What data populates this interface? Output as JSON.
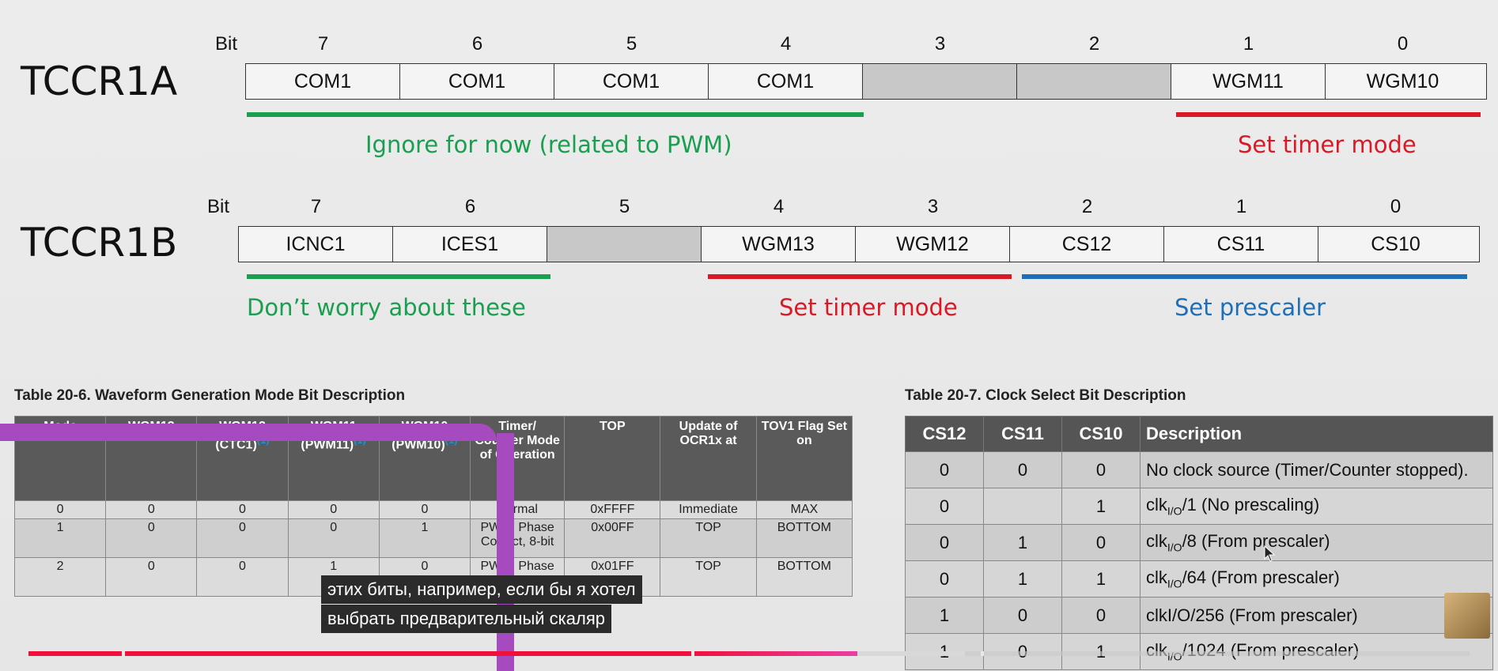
{
  "tccr1a": {
    "name": "TCCR1A",
    "bit_label": "Bit",
    "bits": [
      "7",
      "6",
      "5",
      "4",
      "3",
      "2",
      "1",
      "0"
    ],
    "cells": [
      "COM1",
      "COM1",
      "COM1",
      "COM1",
      "",
      "",
      "WGM11",
      "WGM10"
    ],
    "notes": [
      "Ignore for now (related to PWM)",
      "Set timer mode"
    ]
  },
  "tccr1b": {
    "name": "TCCR1B",
    "bit_label": "Bit",
    "bits": [
      "7",
      "6",
      "5",
      "4",
      "3",
      "2",
      "1",
      "0"
    ],
    "cells": [
      "ICNC1",
      "ICES1",
      "",
      "WGM13",
      "WGM12",
      "CS12",
      "CS11",
      "CS10"
    ],
    "notes": [
      "Don’t worry about these",
      "Set timer mode",
      "Set prescaler"
    ]
  },
  "wgm_table": {
    "title": "Table 20-6.  Waveform Generation Mode Bit Description",
    "headers": [
      "Mode",
      "WGM13",
      "WGM12",
      "WGM11",
      "WGM10",
      "Timer/ Counter Mode of Operation",
      "TOP",
      "Update of OCR1x at",
      "TOV1 Flag Set on"
    ],
    "sub_headers": [
      "",
      "",
      "(CTC1)",
      "(PWM11)",
      "(PWM10)",
      "",
      "",
      "",
      ""
    ],
    "footnote_mark": "(1)",
    "rows": [
      [
        "0",
        "0",
        "0",
        "0",
        "0",
        "Normal",
        "0xFFFF",
        "Immediate",
        "MAX"
      ],
      [
        "1",
        "0",
        "0",
        "0",
        "1",
        "PWM, Phase Correct, 8-bit",
        "0x00FF",
        "TOP",
        "BOTTOM"
      ],
      [
        "2",
        "0",
        "0",
        "1",
        "0",
        "PWM, Phase",
        "0x01FF",
        "TOP",
        "BOTTOM"
      ]
    ]
  },
  "cs_table": {
    "title": "Table 20-7.  Clock Select Bit Description",
    "headers": [
      "CS12",
      "CS11",
      "CS10",
      "Description"
    ],
    "rows": [
      [
        "0",
        "0",
        "0",
        "No clock source (Timer/Counter stopped)."
      ],
      [
        "0",
        "",
        "1",
        "clkI/O/1 (No prescaling)"
      ],
      [
        "0",
        "1",
        "0",
        "clkI/O/8 (From prescaler)"
      ],
      [
        "0",
        "1",
        "1",
        "clkI/O/64 (From prescaler)"
      ],
      [
        "1",
        "0",
        "0",
        "clkI/O/256 (From prescaler)"
      ],
      [
        "1",
        "0",
        "1",
        "clkI/O/1024 (From prescaler)"
      ]
    ]
  },
  "subtitles": {
    "line1": "этих  биты, например, если бы я хотел",
    "line2": "выбрать предварительный скаляр"
  },
  "video": {
    "progress": 0.575,
    "buffered": 0.65
  },
  "colors": {
    "green": "#1a9e50",
    "red": "#d91a26",
    "blue": "#1f6fb8",
    "overlay_purple": "#a64bbf",
    "progress_red": "#f0103c"
  }
}
